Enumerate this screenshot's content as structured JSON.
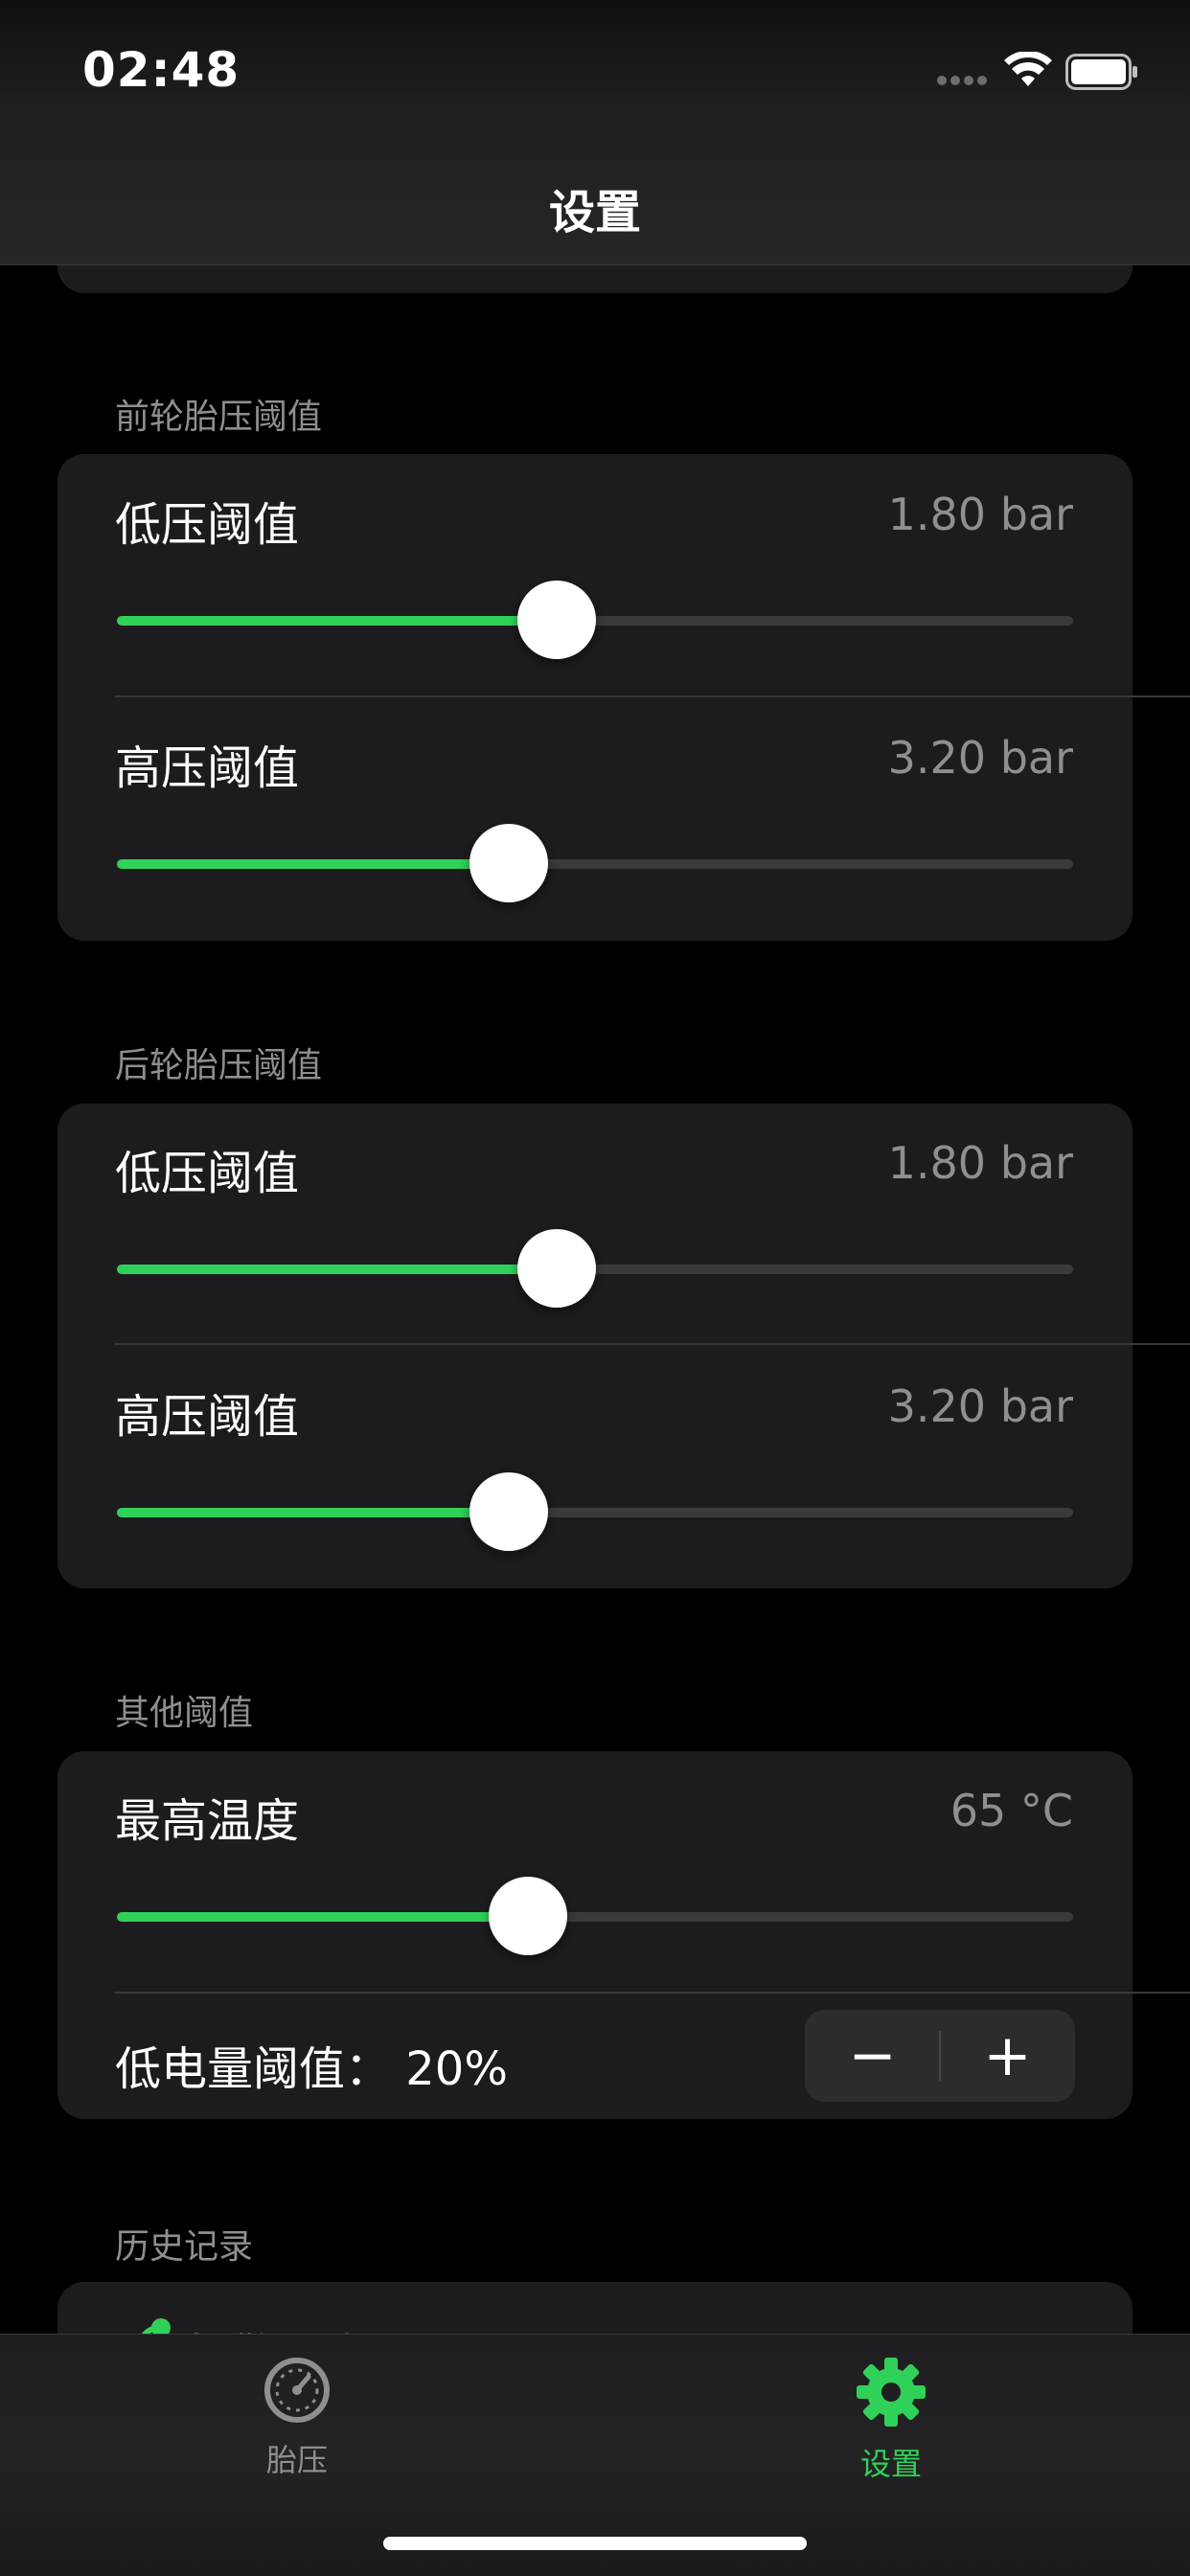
{
  "status_bar": {
    "time": "02:48"
  },
  "nav": {
    "title": "设置"
  },
  "front": {
    "section_label": "前轮胎压阈值",
    "low": {
      "label": "低压阈值",
      "value": "1.80 bar",
      "fraction": 0.46
    },
    "high": {
      "label": "高压阈值",
      "value": "3.20 bar",
      "fraction": 0.41
    }
  },
  "rear": {
    "section_label": "后轮胎压阈值",
    "low": {
      "label": "低压阈值",
      "value": "1.80 bar",
      "fraction": 0.46
    },
    "high": {
      "label": "高压阈值",
      "value": "3.20 bar",
      "fraction": 0.41
    }
  },
  "other": {
    "section_label": "其他阈值",
    "max_temp": {
      "label": "最高温度",
      "value": "65 °C",
      "fraction": 0.43
    },
    "low_battery": {
      "label": "低电量阈值： 20%",
      "minus": "−",
      "plus": "+"
    }
  },
  "history": {
    "section_label": "历史记录",
    "row_label": "报警历史",
    "chevron": "›"
  },
  "tabs": [
    {
      "label": "胎压",
      "icon": "speedometer-icon",
      "selected": false
    },
    {
      "label": "设置",
      "icon": "gear-icon",
      "selected": true
    }
  ],
  "colors": {
    "accent": "#30d158",
    "card": "#1c1c1e",
    "secondary_text": "#8e8e93"
  }
}
